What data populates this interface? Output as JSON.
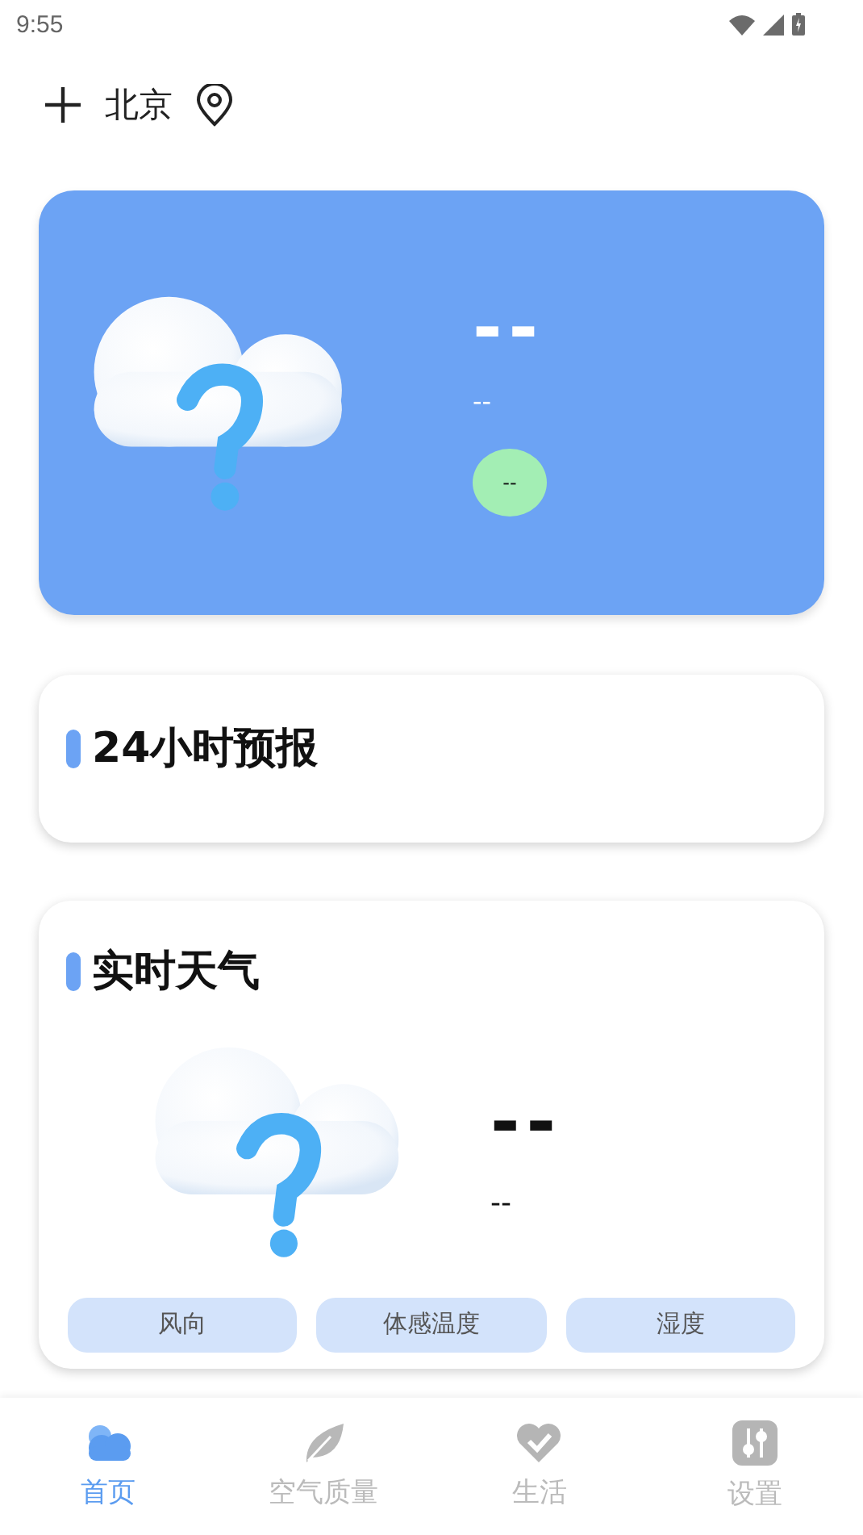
{
  "status_bar": {
    "time": "9:55"
  },
  "header": {
    "city": "北京"
  },
  "current": {
    "temperature": "--",
    "description": "--",
    "air_quality": "--"
  },
  "forecast_24h": {
    "title": "24小时预报"
  },
  "realtime": {
    "title": "实时天气",
    "temperature": "--",
    "description": "--",
    "tiles": [
      {
        "label": "风向"
      },
      {
        "label": "体感温度"
      },
      {
        "label": "湿度"
      }
    ]
  },
  "nav": [
    {
      "label": "首页",
      "selected": true,
      "kind": "cloud"
    },
    {
      "label": "空气质量",
      "selected": false,
      "kind": "leaf"
    },
    {
      "label": "生活",
      "selected": false,
      "kind": "heart"
    },
    {
      "label": "设置",
      "selected": false,
      "kind": "sliders"
    }
  ]
}
